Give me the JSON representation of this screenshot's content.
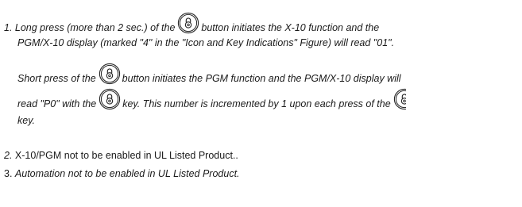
{
  "key_icon": "padlock-key-icon",
  "note1": {
    "l1_a": "1. Long press (more than 2 sec.) of the",
    "l1_b": "button initiates the X-10 function and the",
    "l2": "PGM/X-10 display (marked \"4\" in the \"Icon and Key Indications\" Figure) will read \"01\".",
    "l3_a": "Short press of the",
    "l3_b": "button initiates the PGM function and the PGM/X-10 display will",
    "l4_a": "read \"P0\" with the",
    "l4_b": "key. This number is incremented by 1 upon each press of the",
    "l5": "key."
  },
  "note2": {
    "number": "2.",
    "text": "X-10/PGM not to be enabled in UL Listed Product.."
  },
  "note3": {
    "number": "3.",
    "text": "Automation not to be enabled in UL Listed Product."
  }
}
